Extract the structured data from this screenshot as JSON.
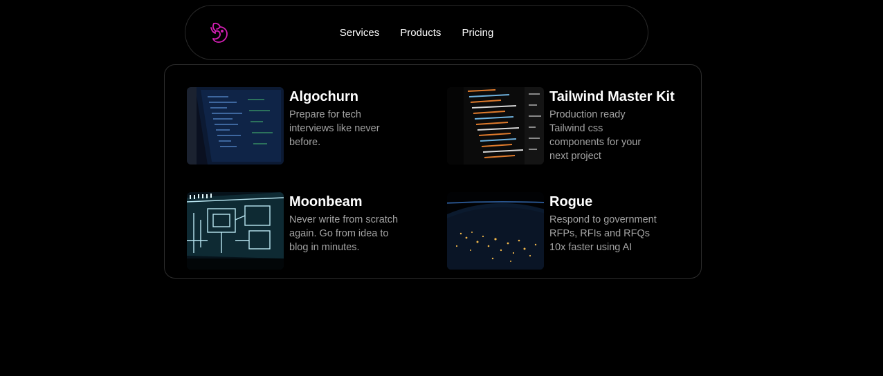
{
  "nav": {
    "logo_icon": "dragon-logo-icon",
    "logo_color": "#d61fb6",
    "links": [
      {
        "label": "Services"
      },
      {
        "label": "Products"
      },
      {
        "label": "Pricing"
      }
    ]
  },
  "products": [
    {
      "title": "Algochurn",
      "description": "Prepare for tech interviews like never before.",
      "thumbnail": "code-editor-screen-image"
    },
    {
      "title": "Tailwind Master Kit",
      "description": "Production ready Tailwind css components for your next project",
      "thumbnail": "orange-code-screen-image"
    },
    {
      "title": "Moonbeam",
      "description": "Never write from scratch again. Go from idea to blog in minutes.",
      "thumbnail": "circuit-board-image"
    },
    {
      "title": "Rogue",
      "description": "Respond to government RFPs, RFIs and RFQs 10x faster using AI",
      "thumbnail": "earth-night-lights-image"
    }
  ],
  "colors": {
    "background": "#000000",
    "border": "#2e2e2e",
    "title": "#ffffff",
    "description": "#a3a3a3"
  }
}
